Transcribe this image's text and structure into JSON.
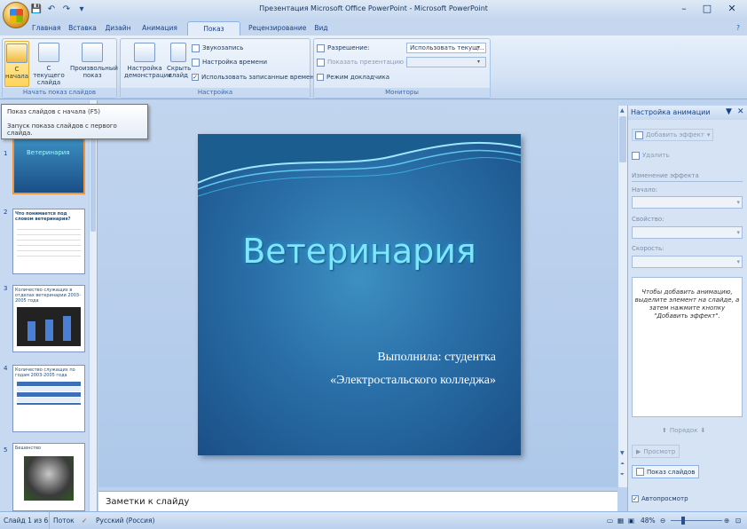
{
  "window": {
    "title": "Презентация Microsoft Office PowerPoint - Microsoft PowerPoint",
    "min_glyph": "–",
    "max_glyph": "□",
    "close_glyph": "✕",
    "help_glyph": "?"
  },
  "qat": {
    "save_glyph": "💾",
    "undo_glyph": "↶",
    "redo_glyph": "↷",
    "more_glyph": "▾"
  },
  "tabs": [
    "Главная",
    "Вставка",
    "Дизайн",
    "Анимация",
    "Показ слайдов",
    "Рецензирование",
    "Вид"
  ],
  "ribbon": {
    "group_start": {
      "label": "Начать показ слайдов",
      "from_start": "С начала",
      "from_current": "С текущего слайда",
      "custom": "Произвольный показ"
    },
    "group_setup": {
      "label": "Настройка",
      "setup_show": "Настройка демонстрации",
      "hide_slide": "Скрыть слайд",
      "record": "Звукозапись",
      "rehearse": "Настройка времени",
      "use_timings": "Использовать записанные времена",
      "use_timings_checked": true
    },
    "group_monitors": {
      "label": "Мониторы",
      "resolution_label": "Разрешение:",
      "resolution_value": "Использовать текущ...",
      "show_on_label": "Показать презентацию на:",
      "presenter_view": "Режим докладчика"
    }
  },
  "tooltip": {
    "title": "Показ слайдов с начала (F5)",
    "body": "Запуск показа слайдов с первого слайда."
  },
  "slides_panel": {
    "thumbs": [
      {
        "num": "1",
        "title": "Ветеринария"
      },
      {
        "num": "2",
        "title": "Что понимается под словом ветеринария?"
      },
      {
        "num": "3",
        "title": "Количество служащих в отделах ветеринарии 2003-2005 года"
      },
      {
        "num": "4",
        "title": "Количество служащих по годам 2003-2005 года"
      },
      {
        "num": "5",
        "title": "Бешенство"
      }
    ]
  },
  "slide": {
    "title": "Ветеринария",
    "sub1": "Выполнила: студентка",
    "sub2": "«Электростальского колледжа»"
  },
  "notes": {
    "placeholder": "Заметки к слайду"
  },
  "task_pane": {
    "title": "Настройка анимации",
    "add_effect": "Добавить эффект",
    "remove": "Удалить",
    "modify_label": "Изменение эффекта",
    "start_label": "Начало:",
    "property_label": "Свойство:",
    "speed_label": "Скорость:",
    "hint": "Чтобы добавить анимацию, выделите элемент на слайде, а затем нажмите кнопку \"Добавить эффект\".",
    "reorder": "Порядок",
    "play": "Просмотр",
    "slideshow": "Показ слайдов",
    "autopreview": "Автопросмотр",
    "autopreview_checked": true
  },
  "status": {
    "slide": "Слайд 1 из 6",
    "theme": "Поток",
    "language": "Русский (Россия)",
    "zoom": "48%"
  },
  "colors": {
    "accent": "#1a4f86",
    "slide_title": "#7fe6ff",
    "ribbon_bg": "#d2e1f4"
  }
}
